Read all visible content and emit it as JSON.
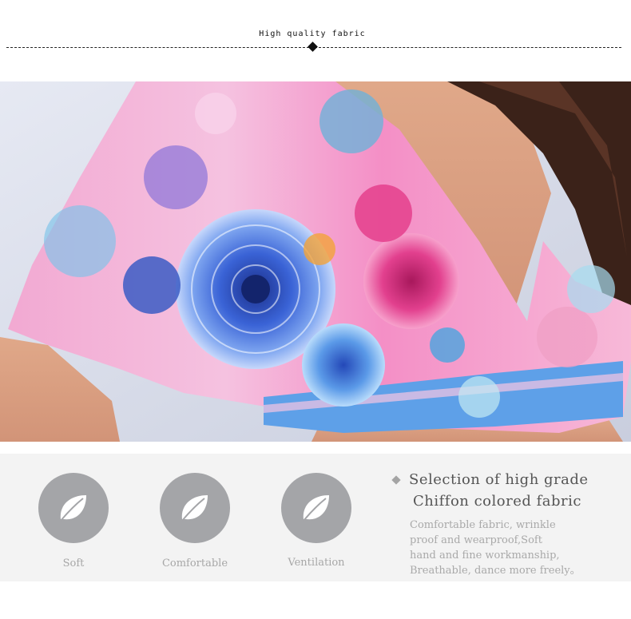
{
  "header": {
    "title": "High quality fabric"
  },
  "features": [
    {
      "label": "Soft",
      "icon": "leaf-icon"
    },
    {
      "label": "Comfortable",
      "icon": "leaf-icon"
    },
    {
      "label": "Ventilation",
      "icon": "leaf-icon"
    }
  ],
  "description": {
    "heading_line1": "Selection of high grade",
    "heading_line2": "Chiffon colored fabric",
    "body_lines": [
      "Comfortable fabric, wrinkle",
      "proof and wearproof,Soft",
      "hand and fine workmanship,",
      "Breathable, dance more freely。"
    ]
  },
  "colors": {
    "feature_circle": "#a4a5a8",
    "feature_band": "#f3f3f3",
    "label_gray": "#a7a7a7"
  }
}
